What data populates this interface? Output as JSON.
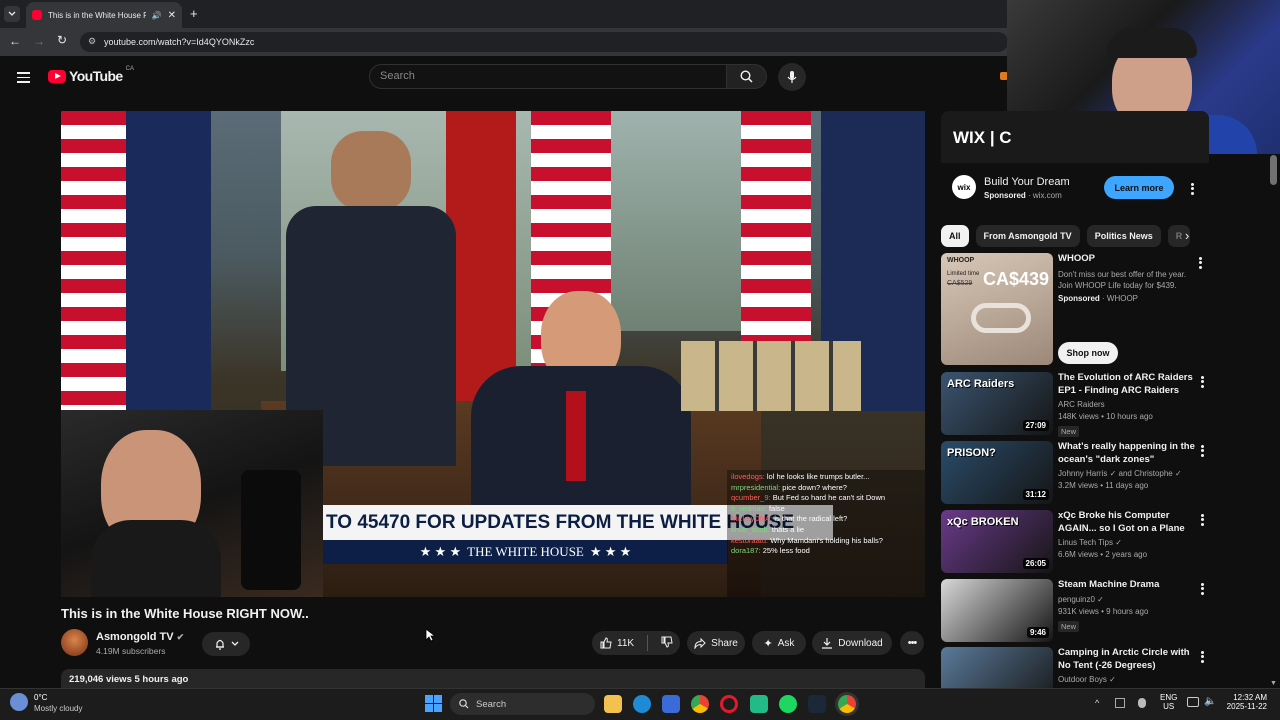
{
  "browser": {
    "tab_title": "This is in the White House RIGHT NOW..",
    "url": "youtube.com/watch?v=Id4QYONkZzc"
  },
  "youtube": {
    "logo_text": "YouTube",
    "region": "CA",
    "search_placeholder": "Search"
  },
  "video": {
    "banner_text": "TO 45470 FOR UPDATES FROM THE WHITE HOUSE",
    "subbanner_text": "THE WHITE HOUSE",
    "stars": "★ ★ ★",
    "chat": [
      {
        "user": "ilovedogs:",
        "msg": "lol he looks like trumps butler..."
      },
      {
        "user": "mrpresidential:",
        "msg": "pice down? where?"
      },
      {
        "user": "qcumber_9:",
        "msg": "But Fed so hard he can't sit Down"
      },
      {
        "user": "tt_redman:",
        "msg": "false"
      },
      {
        "user": "MickeyDNA:",
        "msg": "is that the radical left?"
      },
      {
        "user": "snub_snub:",
        "msg": "thats a lie"
      },
      {
        "user": "kestoraatu:",
        "msg": "Why Mamdani's holding his balls?"
      },
      {
        "user": "dora187:",
        "msg": "25% less food"
      }
    ],
    "title": "This is in the White House RIGHT NOW..",
    "channel": "Asmongold TV",
    "subscribers": "4.19M subscribers",
    "likes": "11K",
    "share_label": "Share",
    "ask_label": "Ask",
    "download_label": "Download",
    "views_date": "219,046 views  5 hours ago"
  },
  "ad": {
    "brand_logo": "WIX | C",
    "title": "Build Your Dream",
    "sponsored": "Sponsored",
    "domain": "wix.com",
    "cta": "Learn more"
  },
  "chips": [
    "All",
    "From Asmongold TV",
    "Politics News",
    "R"
  ],
  "promo": {
    "title": "WHOOP",
    "desc": "Don't miss our best offer of the year. Join WHOOP Life today for $439.",
    "sponsored": "Sponsored",
    "advertiser": "WHOOP",
    "cta": "Shop now",
    "thumb_brand": "WHOOP",
    "thumb_limited": "Limited time",
    "thumb_old_price": "CA$529",
    "thumb_price": "CA$439"
  },
  "recommendations": [
    {
      "title": "The Evolution of ARC Raiders EP1 - Finding ARC Raiders",
      "channel": "ARC Raiders",
      "stats": "148K views • 10 hours ago",
      "badge": "New",
      "duration": "27:09",
      "thumb_text": "ARC Raiders",
      "color": "#3a5570"
    },
    {
      "title": "What's really happening in the ocean's \"dark zones\"",
      "channel": "Johnny Harris  ✓  and Christophe  ✓",
      "stats": "3.2M views • 11 days ago",
      "badge": "",
      "duration": "31:12",
      "thumb_text": "PRISON?",
      "color": "#2a4c6a"
    },
    {
      "title": "xQc Broke his Computer AGAIN... so I Got on a Plane",
      "channel": "Linus Tech Tips  ✓",
      "stats": "6.6M views • 2 years ago",
      "badge": "",
      "duration": "26:05",
      "thumb_text": "xQc BROKEN",
      "color": "#6a3a8a"
    },
    {
      "title": "Steam Machine Drama",
      "channel": "penguinz0  ✓",
      "stats": "931K views • 9 hours ago",
      "badge": "New",
      "duration": "9:46",
      "thumb_text": "",
      "color": "#d8d8d8"
    },
    {
      "title": "Camping in Arctic Circle with No Tent (-26 Degrees)",
      "channel": "Outdoor Boys  ✓",
      "stats": "",
      "badge": "",
      "duration": "",
      "thumb_text": "",
      "color": "#5a7a9a"
    }
  ],
  "taskbar": {
    "weather_temp": "0°C",
    "weather_desc": "Mostly cloudy",
    "search": "Search",
    "lang1": "ENG",
    "lang2": "US",
    "time": "12:32 AM",
    "date": "2025-11-22"
  }
}
